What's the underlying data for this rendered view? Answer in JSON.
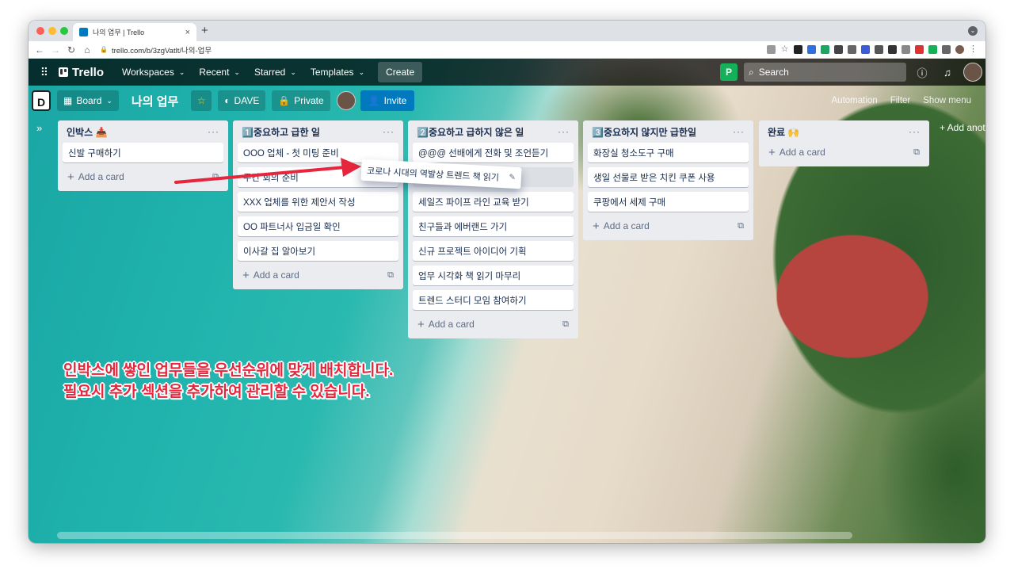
{
  "browser": {
    "tab_title": "나의 업무 | Trello",
    "tab_close": "×",
    "new_tab": "+",
    "url": "trello.com/b/3zgVatlt/나의-업무",
    "nav": {
      "back": "←",
      "forward": "→",
      "reload": "↻",
      "home": "⌂"
    },
    "traffic_colors": [
      "#fe5f57",
      "#febc2e",
      "#28c840"
    ]
  },
  "header": {
    "apps_icon": "⠿",
    "logo": "Trello",
    "menus": [
      {
        "label": "Workspaces",
        "chev": "⌄"
      },
      {
        "label": "Recent",
        "chev": "⌄"
      },
      {
        "label": "Starred",
        "chev": "⌄"
      },
      {
        "label": "Templates",
        "chev": "⌄"
      }
    ],
    "create": "Create",
    "search_placeholder": "Search",
    "info_icon": "ⓘ",
    "bell_icon": "🔔"
  },
  "board": {
    "view": "Board",
    "title": "나의 업무",
    "star": "☆",
    "workspace": "DAVE",
    "visibility": "Private",
    "invite": "Invite",
    "automation": "Automation",
    "filter": "Filter",
    "show_menu": "Show menu",
    "add_another_list": "+ Add another list"
  },
  "lists": [
    {
      "title": "인박스 📥",
      "cards": [
        "신발 구매하기"
      ],
      "add": "Add a card"
    },
    {
      "title": "1️⃣중요하고 급한 일",
      "cards": [
        "OOO 업체 - 첫 미팅 준비",
        "주간 회의 준비",
        "XXX 업체를 위한 제안서 작성",
        "OO 파트너사 입금일 확인",
        "이사갈 집 알아보기"
      ],
      "add": "Add a card"
    },
    {
      "title": "2️⃣중요하고 급하지 않은 일",
      "cards": [
        "@@@ 선배에게 전화 및 조언듣기",
        "",
        "세일즈 파이프 라인 교육 받기",
        "친구들과 에버랜드 가기",
        "신규 프로젝트 아이디어 기획",
        "업무 시각화 책 읽기 마무리",
        "트렌드 스터디 모임 참여하기"
      ],
      "add": "Add a card"
    },
    {
      "title": "3️⃣중요하지 않지만 급한일",
      "cards": [
        "화장실 청소도구 구매",
        "생일 선물로 받은 치킨 쿠폰 사용",
        "쿠팡에서 세제 구매"
      ],
      "add": "Add a card"
    },
    {
      "title": "완료 🙌",
      "cards": [],
      "add": "Add a card"
    }
  ],
  "dragging_card": "코로나 시대의 역발상 트렌드 책 읽기",
  "annotation": {
    "line1": "인박스에 쌓인 업무들을 우선순위에 맞게 배치합니다.",
    "line2": "필요시 추가 섹션을 추가하여 관리할 수 있습니다."
  },
  "colors": {
    "accent": "#0079bf",
    "annotation": "#e6263c",
    "trello_green": "#14b158"
  }
}
